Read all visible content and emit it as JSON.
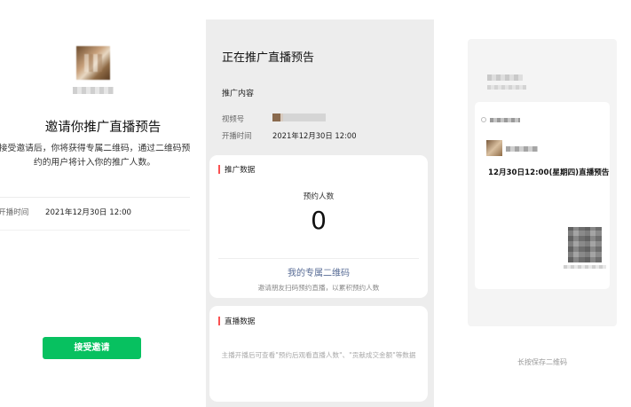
{
  "invite": {
    "title": "邀请你推广直播预告",
    "description": "接受邀请后，你将获得专属二维码，通过二维码预约的用户将计入你的推广人数。",
    "time_label": "开播时间",
    "time_value": "2021年12月30日 12:00",
    "accept_button": "接受邀请",
    "accent_color": "#07c160"
  },
  "promo": {
    "title": "正在推广直播预告",
    "content_heading": "推广内容",
    "channel_label": "视频号",
    "start_label": "开播时间",
    "start_value": "2021年12月30日 12:00",
    "data_card": {
      "title": "推广数据",
      "stat_label": "预约人数",
      "stat_value": "0",
      "qr_link": "我的专属二维码",
      "qr_hint": "邀请朋友扫码预约直播，以累积预约人数"
    },
    "live_card": {
      "title": "直播数据",
      "empty_text": "主播开播后可查看\"预约后观看直播人数\"、\"贡献成交金额\"等数据"
    },
    "accent_bar_color": "#fa5151"
  },
  "poster": {
    "live_title": "12月30日12:00(星期四)直播预告",
    "save_hint": "长按保存二维码"
  }
}
